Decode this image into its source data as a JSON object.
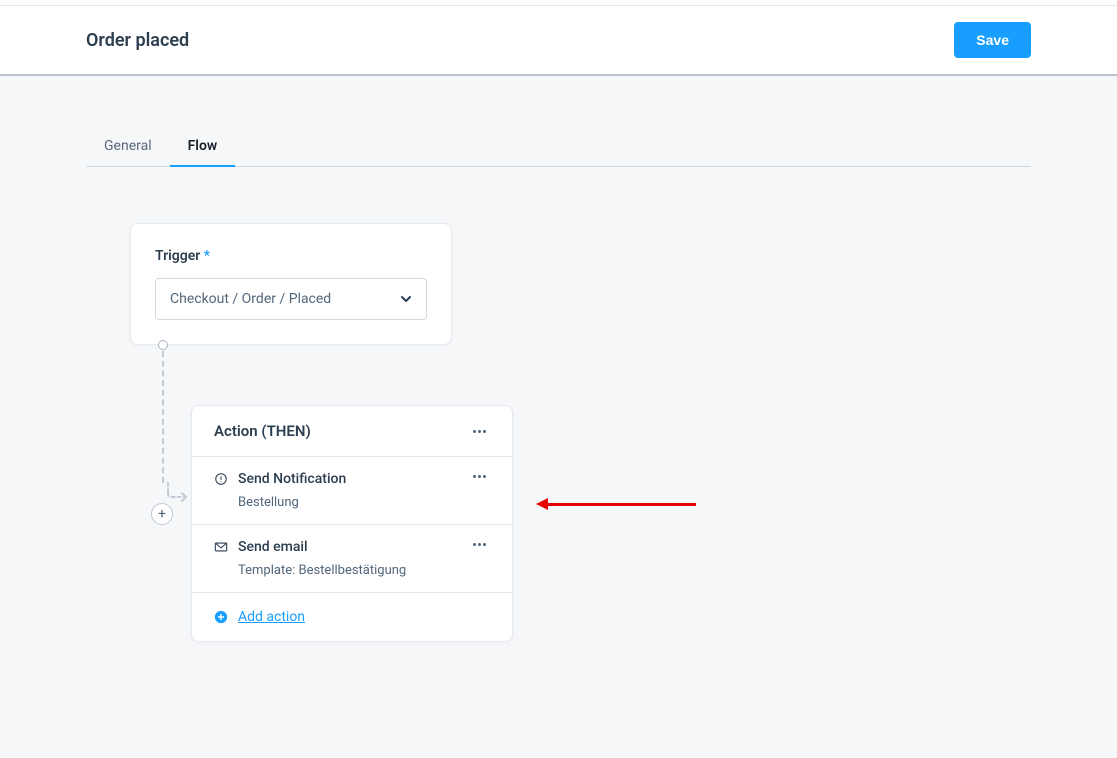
{
  "header": {
    "title": "Order placed",
    "save_label": "Save"
  },
  "tabs": {
    "general": "General",
    "flow": "Flow"
  },
  "trigger": {
    "label": "Trigger",
    "required_mark": "*",
    "value": "Checkout / Order / Placed"
  },
  "action": {
    "title": "Action (THEN)",
    "items": [
      {
        "icon": "clock-alert-icon",
        "title": "Send Notification",
        "subtitle": "Bestellung"
      },
      {
        "icon": "mail-icon",
        "title": "Send email",
        "subtitle": "Template: Bestellbestätigung"
      }
    ],
    "add_label": "Add action"
  }
}
